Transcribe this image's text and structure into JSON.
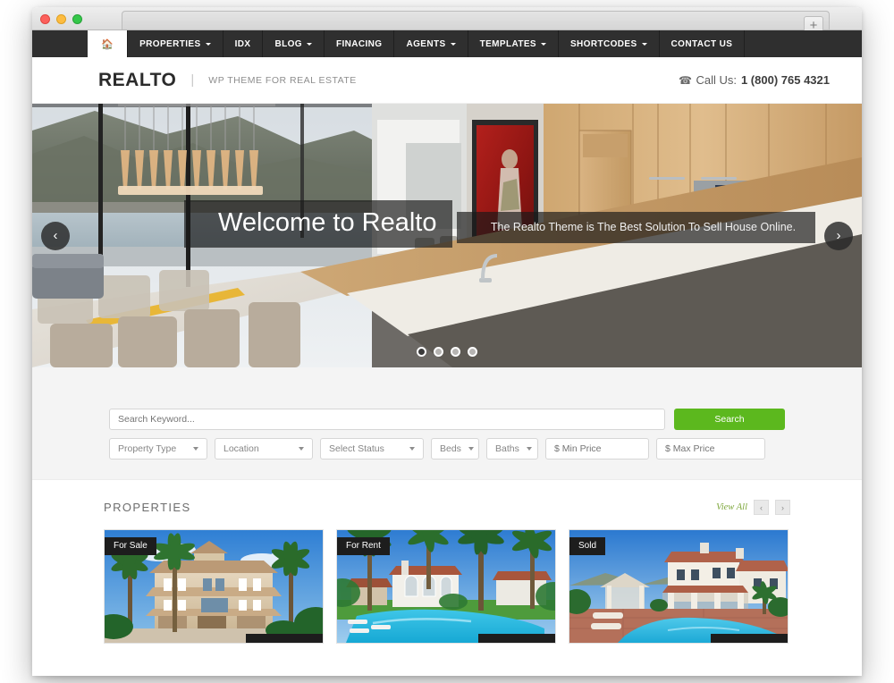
{
  "browser": {
    "traffic_lights": [
      "close",
      "minimize",
      "zoom"
    ],
    "new_tab_label": "+"
  },
  "nav": {
    "home_icon": "home-icon",
    "items": [
      {
        "label": "PROPERTIES",
        "has_dropdown": true
      },
      {
        "label": "IDX",
        "has_dropdown": false
      },
      {
        "label": "BLOG",
        "has_dropdown": true
      },
      {
        "label": "FINACING",
        "has_dropdown": false
      },
      {
        "label": "AGENTS",
        "has_dropdown": true
      },
      {
        "label": "TEMPLATES",
        "has_dropdown": true
      },
      {
        "label": "SHORTCODES",
        "has_dropdown": true
      },
      {
        "label": "CONTACT US",
        "has_dropdown": false
      }
    ]
  },
  "header": {
    "brand": "REALTO",
    "divider": "|",
    "tagline": "WP THEME FOR REAL ESTATE",
    "phone_icon": "phone-icon",
    "phone_label": "Call Us:",
    "phone_number": "1 (800) 765 4321"
  },
  "hero": {
    "title": "Welcome to Realto",
    "subtitle": "The Realto Theme is The Best Solution To Sell House Online.",
    "prev_icon": "chevron-left-icon",
    "prev_glyph": "‹",
    "next_icon": "chevron-right-icon",
    "next_glyph": "›",
    "dot_count": 4,
    "active_dot": 1
  },
  "search": {
    "keyword_placeholder": "Search Keyword...",
    "submit_label": "Search",
    "submit_color": "#5cb81e",
    "filters": [
      {
        "name": "property-type",
        "label": "Property Type",
        "kind": "select"
      },
      {
        "name": "location",
        "label": "Location",
        "kind": "select"
      },
      {
        "name": "select-status",
        "label": "Select Status",
        "kind": "select"
      },
      {
        "name": "beds",
        "label": "Beds",
        "kind": "select"
      },
      {
        "name": "baths",
        "label": "Baths",
        "kind": "select"
      }
    ],
    "min_price_placeholder": "$ Min Price",
    "max_price_placeholder": "$ Max Price"
  },
  "properties": {
    "section_title": "PROPERTIES",
    "view_all_label": "View All",
    "prev_glyph": "‹",
    "next_glyph": "›",
    "cards": [
      {
        "badge": "For Sale",
        "alt": "Three-story Mediterranean mansion with palm trees"
      },
      {
        "badge": "For Rent",
        "alt": "White villa with pool surrounded by palm trees"
      },
      {
        "badge": "Sold",
        "alt": "Spanish-style home with pool and cabana"
      }
    ]
  },
  "colors": {
    "nav_bg": "#2f2f2f",
    "accent_green": "#5cb81e",
    "view_all_green": "#7fa83e",
    "band_bg": "#f4f4f4"
  }
}
